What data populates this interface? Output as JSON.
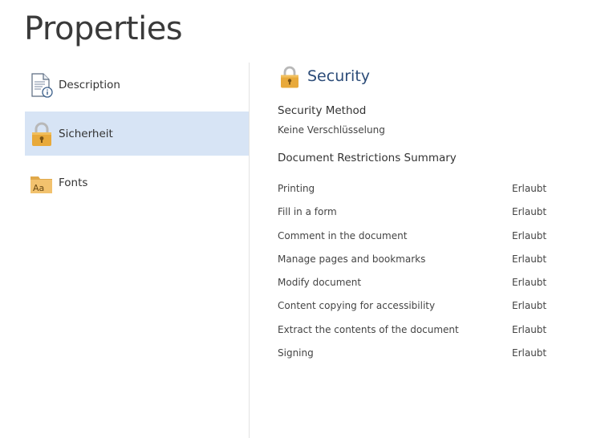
{
  "page": {
    "title": "Properties"
  },
  "sidebar": {
    "items": [
      {
        "label": "Description",
        "icon": "document-info-icon",
        "selected": false
      },
      {
        "label": "Sicherheit",
        "icon": "lock-icon",
        "selected": true
      },
      {
        "label": "Fonts",
        "icon": "font-folder-icon",
        "selected": false
      }
    ]
  },
  "security": {
    "title": "Security",
    "icon": "lock-icon",
    "method_heading": "Security Method",
    "method_value": "Keine Verschlüsselung",
    "summary_heading": "Document Restrictions Summary",
    "restrictions": [
      {
        "name": "Printing",
        "value": "Erlaubt"
      },
      {
        "name": "Fill in a form",
        "value": "Erlaubt"
      },
      {
        "name": "Comment in the document",
        "value": "Erlaubt"
      },
      {
        "name": "Manage pages and bookmarks",
        "value": "Erlaubt"
      },
      {
        "name": "Modify document",
        "value": "Erlaubt"
      },
      {
        "name": "Content copying for accessibility",
        "value": "Erlaubt"
      },
      {
        "name": "Extract the contents of the document",
        "value": "Erlaubt"
      },
      {
        "name": "Signing",
        "value": "Erlaubt"
      }
    ]
  },
  "colors": {
    "selected_bg": "#d7e4f5",
    "accent_title": "#2b4b78",
    "lock_gold": "#e8a93a"
  }
}
